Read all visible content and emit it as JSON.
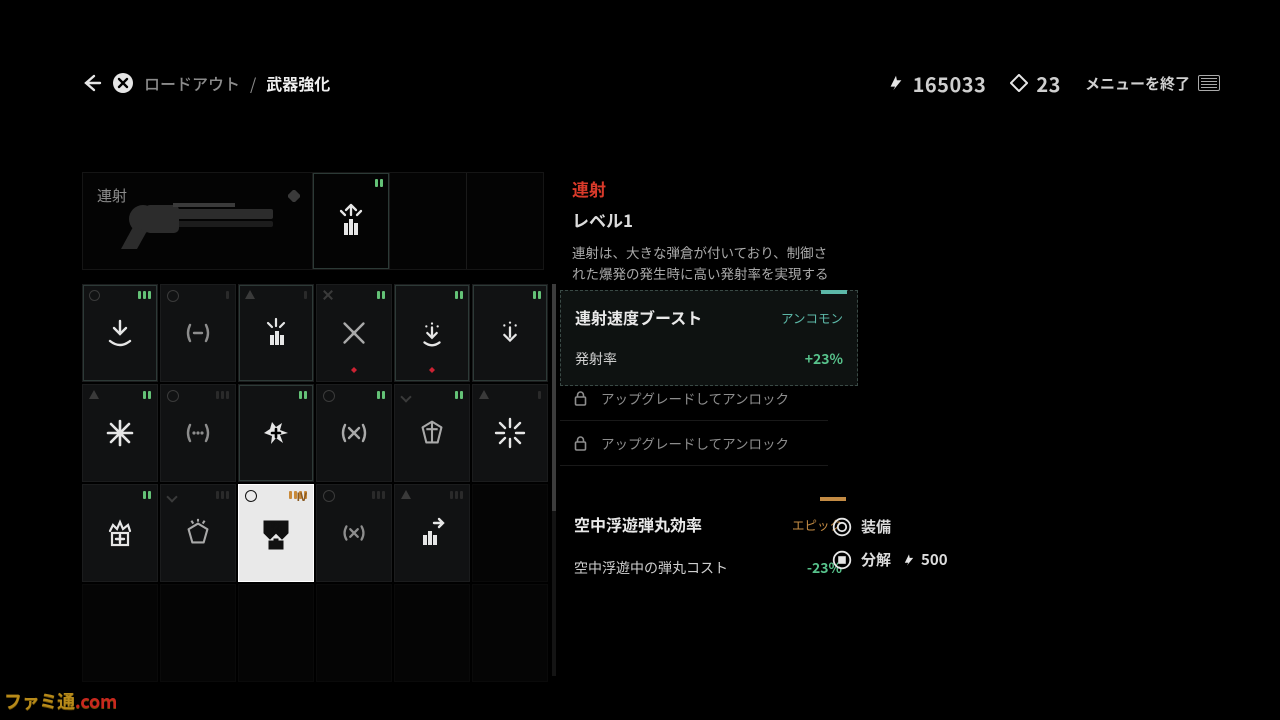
{
  "breadcrumb": {
    "prev": "ロードアウト",
    "current": "武器強化"
  },
  "currencies": {
    "scrap": "165033",
    "orbs": "23"
  },
  "menu_exit": "メニューを終了",
  "weapon": {
    "name_chip": "連射",
    "title": "連射",
    "level": "レベル1",
    "description": "連射は、大きな弾倉が付いており、制御された爆発の発生時に高い発射率を実現する"
  },
  "perk_card": {
    "name": "連射速度ブースト",
    "rarity": "アンコモン",
    "stat_label": "発射率",
    "stat_value": "+23%"
  },
  "locked_rows": [
    "アップグレードしてアンロック",
    "アップグレードしてアンロック"
  ],
  "perk_card2": {
    "name": "空中浮遊弾丸効率",
    "rarity": "エピック",
    "stat_label": "空中浮遊中の弾丸コスト",
    "stat_value": "-23%"
  },
  "actions": {
    "equip": "装備",
    "dismantle": "分解",
    "dismantle_cost": "500"
  },
  "watermark": "ファミ通.com"
}
